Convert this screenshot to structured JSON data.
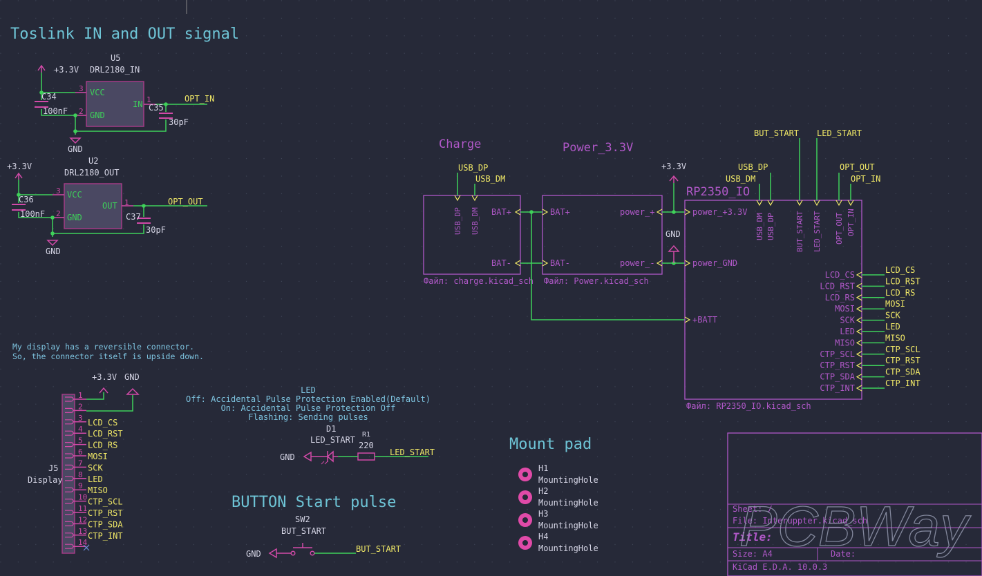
{
  "colors": {
    "background": "#262938",
    "wire": "#3fd15a",
    "pin": "#d24aa8",
    "comp_body": "#4a4862",
    "comp_border": "#a23a86",
    "pin_text": "#3ed05a",
    "label_yellow": "#f0e867",
    "ref_text": "#d6d6e6",
    "section_title": "#6ec4d6",
    "sheet_text": "#b058c8",
    "note_text": "#7ec4e0",
    "junction": "#3fd15a",
    "mount_pad": "#e04aa8"
  },
  "sections": {
    "toslink_title": "Toslink IN and OUT signal",
    "charge_title": "Charge",
    "power_title": "Power_3.3V",
    "mount_title": "Mount pad",
    "button_title": "BUTTON Start pulse"
  },
  "u5": {
    "ref": "U5",
    "value": "DRL2180_IN",
    "pin_vcc": "VCC",
    "pin_gnd": "GND",
    "pin_in": "IN",
    "n3": "3",
    "n2": "2",
    "n1": "1"
  },
  "u2": {
    "ref": "U2",
    "value": "DRL2180_OUT",
    "pin_vcc": "VCC",
    "pin_gnd": "GND",
    "pin_out": "OUT",
    "n3": "3",
    "n2": "2",
    "n1": "1"
  },
  "caps": {
    "c34": "C34",
    "c34_val": "100nF",
    "c35": "C35",
    "c35_val": "30pF",
    "c36": "C36",
    "c36_val": "100nF",
    "c37": "C37",
    "c37_val": "30pF"
  },
  "power": {
    "v33": "+3.3V",
    "gnd": "GND"
  },
  "nets": {
    "opt_in": "OPT_IN",
    "opt_out": "OPT_OUT",
    "usb_dp": "USB_DP",
    "usb_dm": "USB_DM",
    "but_start": "BUT_START",
    "led_start": "LED_START"
  },
  "charge_sheet": {
    "name": "Charge",
    "file": "Файл: charge.kicad_sch",
    "pins": {
      "usb_dp": "USB_DP",
      "usb_dm": "USB_DM",
      "bat_p": "BAT+",
      "bat_m": "BAT-"
    }
  },
  "power_sheet": {
    "file": "Файл: Power.kicad_sch",
    "pins": {
      "bat_p": "BAT+",
      "bat_m": "BAT-",
      "pp": "power_+",
      "pm": "power_-"
    }
  },
  "io_sheet": {
    "name": "RP2350_IO",
    "file": "Файл: RP2350_IO.kicad_sch",
    "left_pins": [
      "power_+3.3V",
      "power_GND",
      "+BATT"
    ],
    "top_pins": [
      "USB_DM",
      "USB_DP",
      "BUT_START",
      "LED_START",
      "OPT_OUT",
      "OPT_IN"
    ],
    "right_pins": [
      "LCD_CS",
      "LCD_RST",
      "LCD_RS",
      "MOSI",
      "SCK",
      "LED",
      "MISO",
      "CTP_SCL",
      "CTP_RST",
      "CTP_SDA",
      "CTP_INT"
    ],
    "right_labels": [
      "LCD_CS",
      "LCD_RST",
      "LCD_RS",
      "MOSI",
      "SCK",
      "LED",
      "MISO",
      "CTP_SCL",
      "CTP_RST",
      "CTP_SDA",
      "CTP_INT"
    ]
  },
  "display_note": [
    "My display has a reversible connector.",
    "So, the connector itself is upside down."
  ],
  "j5": {
    "ref": "J5",
    "value": "Display",
    "pins": [
      {
        "n": "1",
        "label": ""
      },
      {
        "n": "2",
        "label": ""
      },
      {
        "n": "3",
        "label": "LCD_CS"
      },
      {
        "n": "4",
        "label": "LCD_RST"
      },
      {
        "n": "5",
        "label": "LCD_RS"
      },
      {
        "n": "6",
        "label": "MOSI"
      },
      {
        "n": "7",
        "label": "SCK"
      },
      {
        "n": "8",
        "label": "LED"
      },
      {
        "n": "9",
        "label": "MISO"
      },
      {
        "n": "10",
        "label": "CTP_SCL"
      },
      {
        "n": "11",
        "label": "CTP_RST"
      },
      {
        "n": "12",
        "label": "CTP_SDA"
      },
      {
        "n": "13",
        "label": "CTP_INT"
      },
      {
        "n": "14",
        "label": ""
      }
    ]
  },
  "led_note": [
    "LED",
    "Off: Accidental Pulse Protection Enabled(Default)",
    "On: Accidental Pulse Protection Off",
    "Flashing: Sending pulses"
  ],
  "d1": {
    "ref": "D1",
    "value": "LED_START"
  },
  "r1": {
    "ref": "R1",
    "value": "220"
  },
  "sw2": {
    "ref": "SW2",
    "value": "BUT_START"
  },
  "holes": [
    {
      "ref": "H1",
      "value": "MountingHole"
    },
    {
      "ref": "H2",
      "value": "MountingHole"
    },
    {
      "ref": "H3",
      "value": "MountingHole"
    },
    {
      "ref": "H4",
      "value": "MountingHole"
    }
  ],
  "title_block": {
    "sheet": "Sheet: /",
    "file": "File: Interuppter.kicad_sch",
    "title": "Title:",
    "size": "Size: A4",
    "date": "Date:",
    "tool": "KiCad E.D.A. 10.0.3",
    "watermark": "PCBWay"
  }
}
